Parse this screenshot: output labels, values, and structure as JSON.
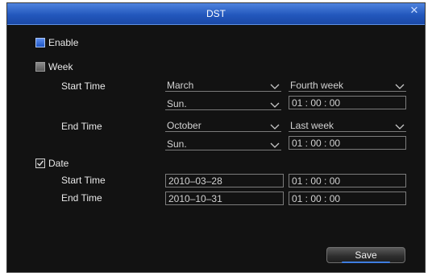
{
  "dialog": {
    "title": "DST",
    "close_glyph": "✕"
  },
  "enable": {
    "label": "Enable",
    "checked": true
  },
  "week": {
    "label": "Week",
    "checked": false,
    "start_label": "Start Time",
    "end_label": "End Time",
    "start_month": "March",
    "start_week": "Fourth  week",
    "start_day": "Sun.",
    "start_time": "01 : 00 : 00",
    "end_month": "October",
    "end_week": "Last  week",
    "end_day": "Sun.",
    "end_time": "01 : 00 : 00"
  },
  "date": {
    "label": "Date",
    "checked": true,
    "start_label": "Start Time",
    "end_label": "End Time",
    "start_date": "2010–03–28",
    "start_time": "01 : 00 : 00",
    "end_date": "2010–10–31",
    "end_time": "01 : 00 : 00"
  },
  "buttons": {
    "save_label": "Save"
  },
  "colors": {
    "title_bar": "#2358bd",
    "background": "#121212",
    "accent": "#3e7de0"
  },
  "icons": [
    "close-icon",
    "checkbox-icon",
    "chevron-down-icon",
    "checkmark-icon"
  ]
}
